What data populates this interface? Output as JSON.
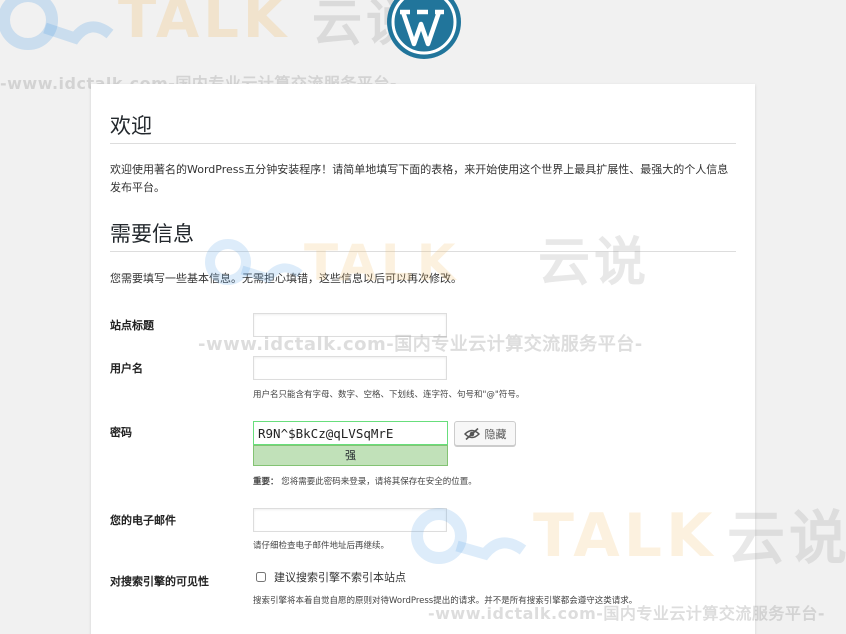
{
  "watermark": {
    "brand": "TALK",
    "brand_cn": "云说",
    "url_text": "-www.idctalk.com-国内专业云计算交流服务平台-"
  },
  "icons": {
    "logo": "wordpress-logo",
    "hide": "eye-slash-icon"
  },
  "colors": {
    "password_border": "#68de7c",
    "strength_bg": "#c1e1b9",
    "wordpress_blue": "#21759b"
  },
  "welcome": {
    "title": "欢迎",
    "text": "欢迎使用著名的WordPress五分钟安装程序！请简单地填写下面的表格，来开始使用这个世界上最具扩展性、最强大的个人信息发布平台。"
  },
  "info": {
    "title": "需要信息",
    "text": "您需要填写一些基本信息。无需担心填错，这些信息以后可以再次修改。"
  },
  "form": {
    "site_title": {
      "label": "站点标题",
      "value": ""
    },
    "username": {
      "label": "用户名",
      "value": "",
      "hint": "用户名只能含有字母、数字、空格、下划线、连字符、句号和\"@\"符号。"
    },
    "password": {
      "label": "密码",
      "value": "R9N^$BkCz@qLVSqMrE",
      "strength": "强",
      "hide_label": "隐藏",
      "hint_strong": "重要：",
      "hint": "您将需要此密码来登录，请将其保存在安全的位置。"
    },
    "email": {
      "label": "您的电子邮件",
      "value": "",
      "hint": "请仔细检查电子邮件地址后再继续。"
    },
    "visibility": {
      "label": "对搜索引擎的可见性",
      "checkbox_label": "建议搜索引擎不索引本站点",
      "checked": false,
      "hint": "搜索引擎将本着自觉自愿的原则对待WordPress提出的请求。并不是所有搜索引擎都会遵守这类请求。"
    }
  }
}
